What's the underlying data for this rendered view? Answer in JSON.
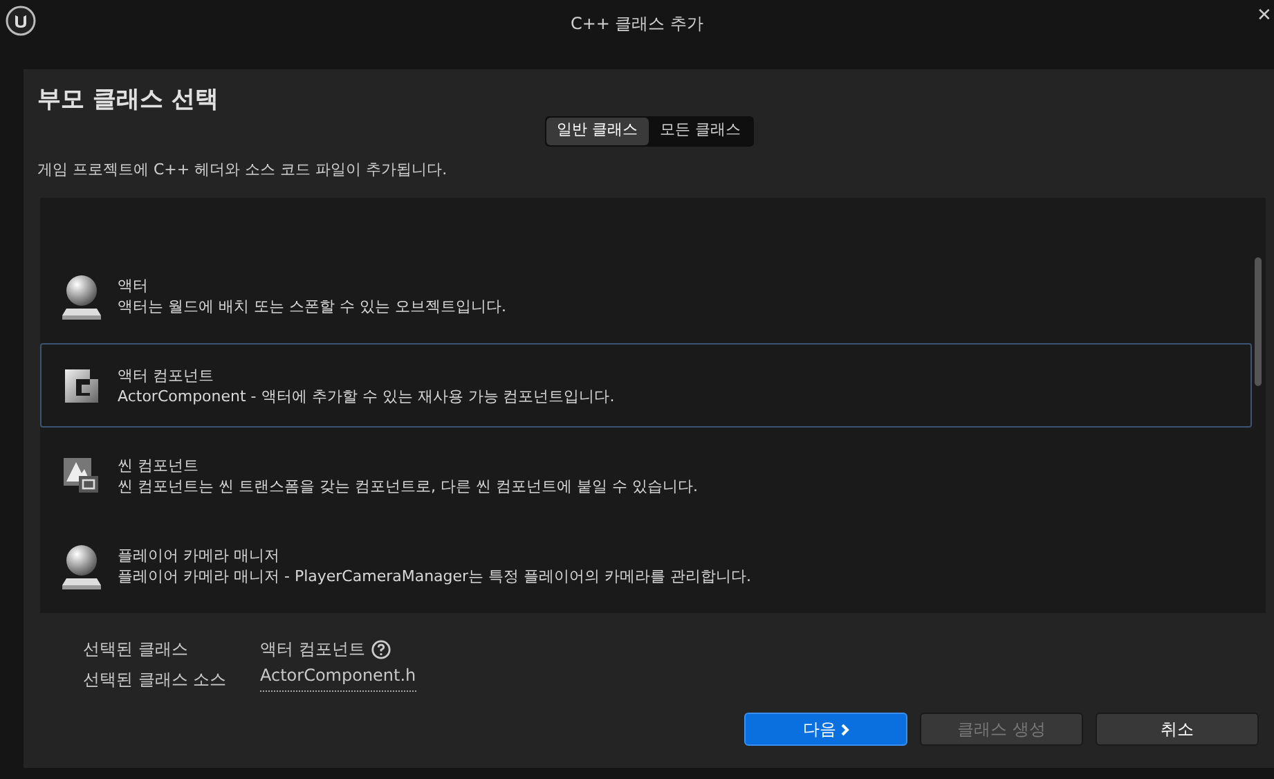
{
  "window": {
    "title": "C++ 클래스 추가",
    "close": "✕"
  },
  "heading": "부모 클래스 선택",
  "tabs": [
    {
      "label": "일반 클래스",
      "selected": true
    },
    {
      "label": "모든 클래스",
      "selected": false
    }
  ],
  "description": "게임 프로젝트에 C++ 헤더와 소스 코드 파일이 추가됩니다.",
  "classes": [
    {
      "kind": "sphere",
      "name": "액터",
      "description": "액터는 월드에 배치 또는 스폰할 수 있는 오브젝트입니다.",
      "selected": false
    },
    {
      "kind": "component",
      "name": "액터 컴포넌트",
      "description": "ActorComponent - 액터에 추가할 수 있는 재사용 가능 컴포넌트입니다.",
      "selected": true
    },
    {
      "kind": "scene",
      "name": "씬 컴포넌트",
      "description": "씬 컴포넌트는 씬 트랜스폼을 갖는 컴포넌트로, 다른 씬 컴포넌트에 붙일 수 있습니다.",
      "selected": false
    },
    {
      "kind": "sphere",
      "name": "플레이어 카메라 매니저",
      "description": "플레이어 카메라 매니저 - PlayerCameraManager는 특정 플레이어의 카메라를 관리합니다.",
      "selected": false
    }
  ],
  "selected_class": {
    "label": "선택된 클래스",
    "value": "액터 컴포넌트"
  },
  "selected_source": {
    "label": "선택된 클래스 소스",
    "value": "ActorComponent.h"
  },
  "buttons": [
    {
      "label": "다음",
      "kind": "primary",
      "disabled": false
    },
    {
      "label": "클래스 생성",
      "kind": "normal",
      "disabled": true
    },
    {
      "label": "취소",
      "kind": "normal",
      "disabled": false
    }
  ]
}
